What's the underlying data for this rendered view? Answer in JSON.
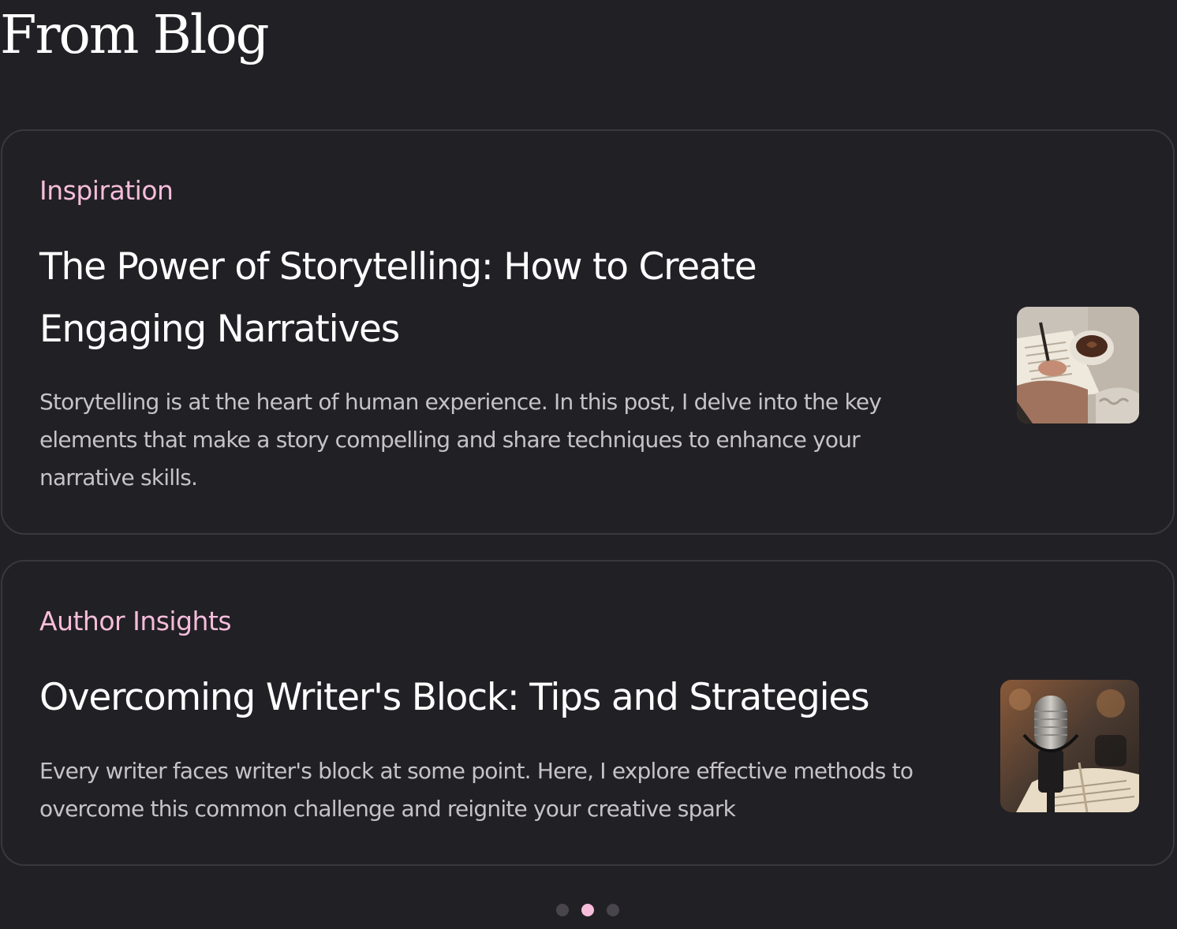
{
  "section": {
    "title": "From Blog"
  },
  "posts": [
    {
      "category": "Inspiration",
      "title": "The Power of Storytelling: How to Create Engaging Narratives",
      "excerpt": "Storytelling is at the heart of human experience. In this post, I delve into the key elements that make a story compelling and share techniques to enhance your narrative skills.",
      "image": "writing-journal-with-coffee-image"
    },
    {
      "category": "Author Insights",
      "title": "Overcoming Writer's Block: Tips and Strategies",
      "excerpt": "Every writer faces writer's block at some point. Here, I explore effective methods to overcome this common challenge and reignite your creative spark",
      "image": "microphone-and-book-image"
    }
  ],
  "pagination": {
    "total": 3,
    "active_index": 1
  },
  "colors": {
    "background": "#212025",
    "accent": "#f6bddb",
    "border": "#3a373e",
    "muted_text": "#c5c2c8"
  }
}
